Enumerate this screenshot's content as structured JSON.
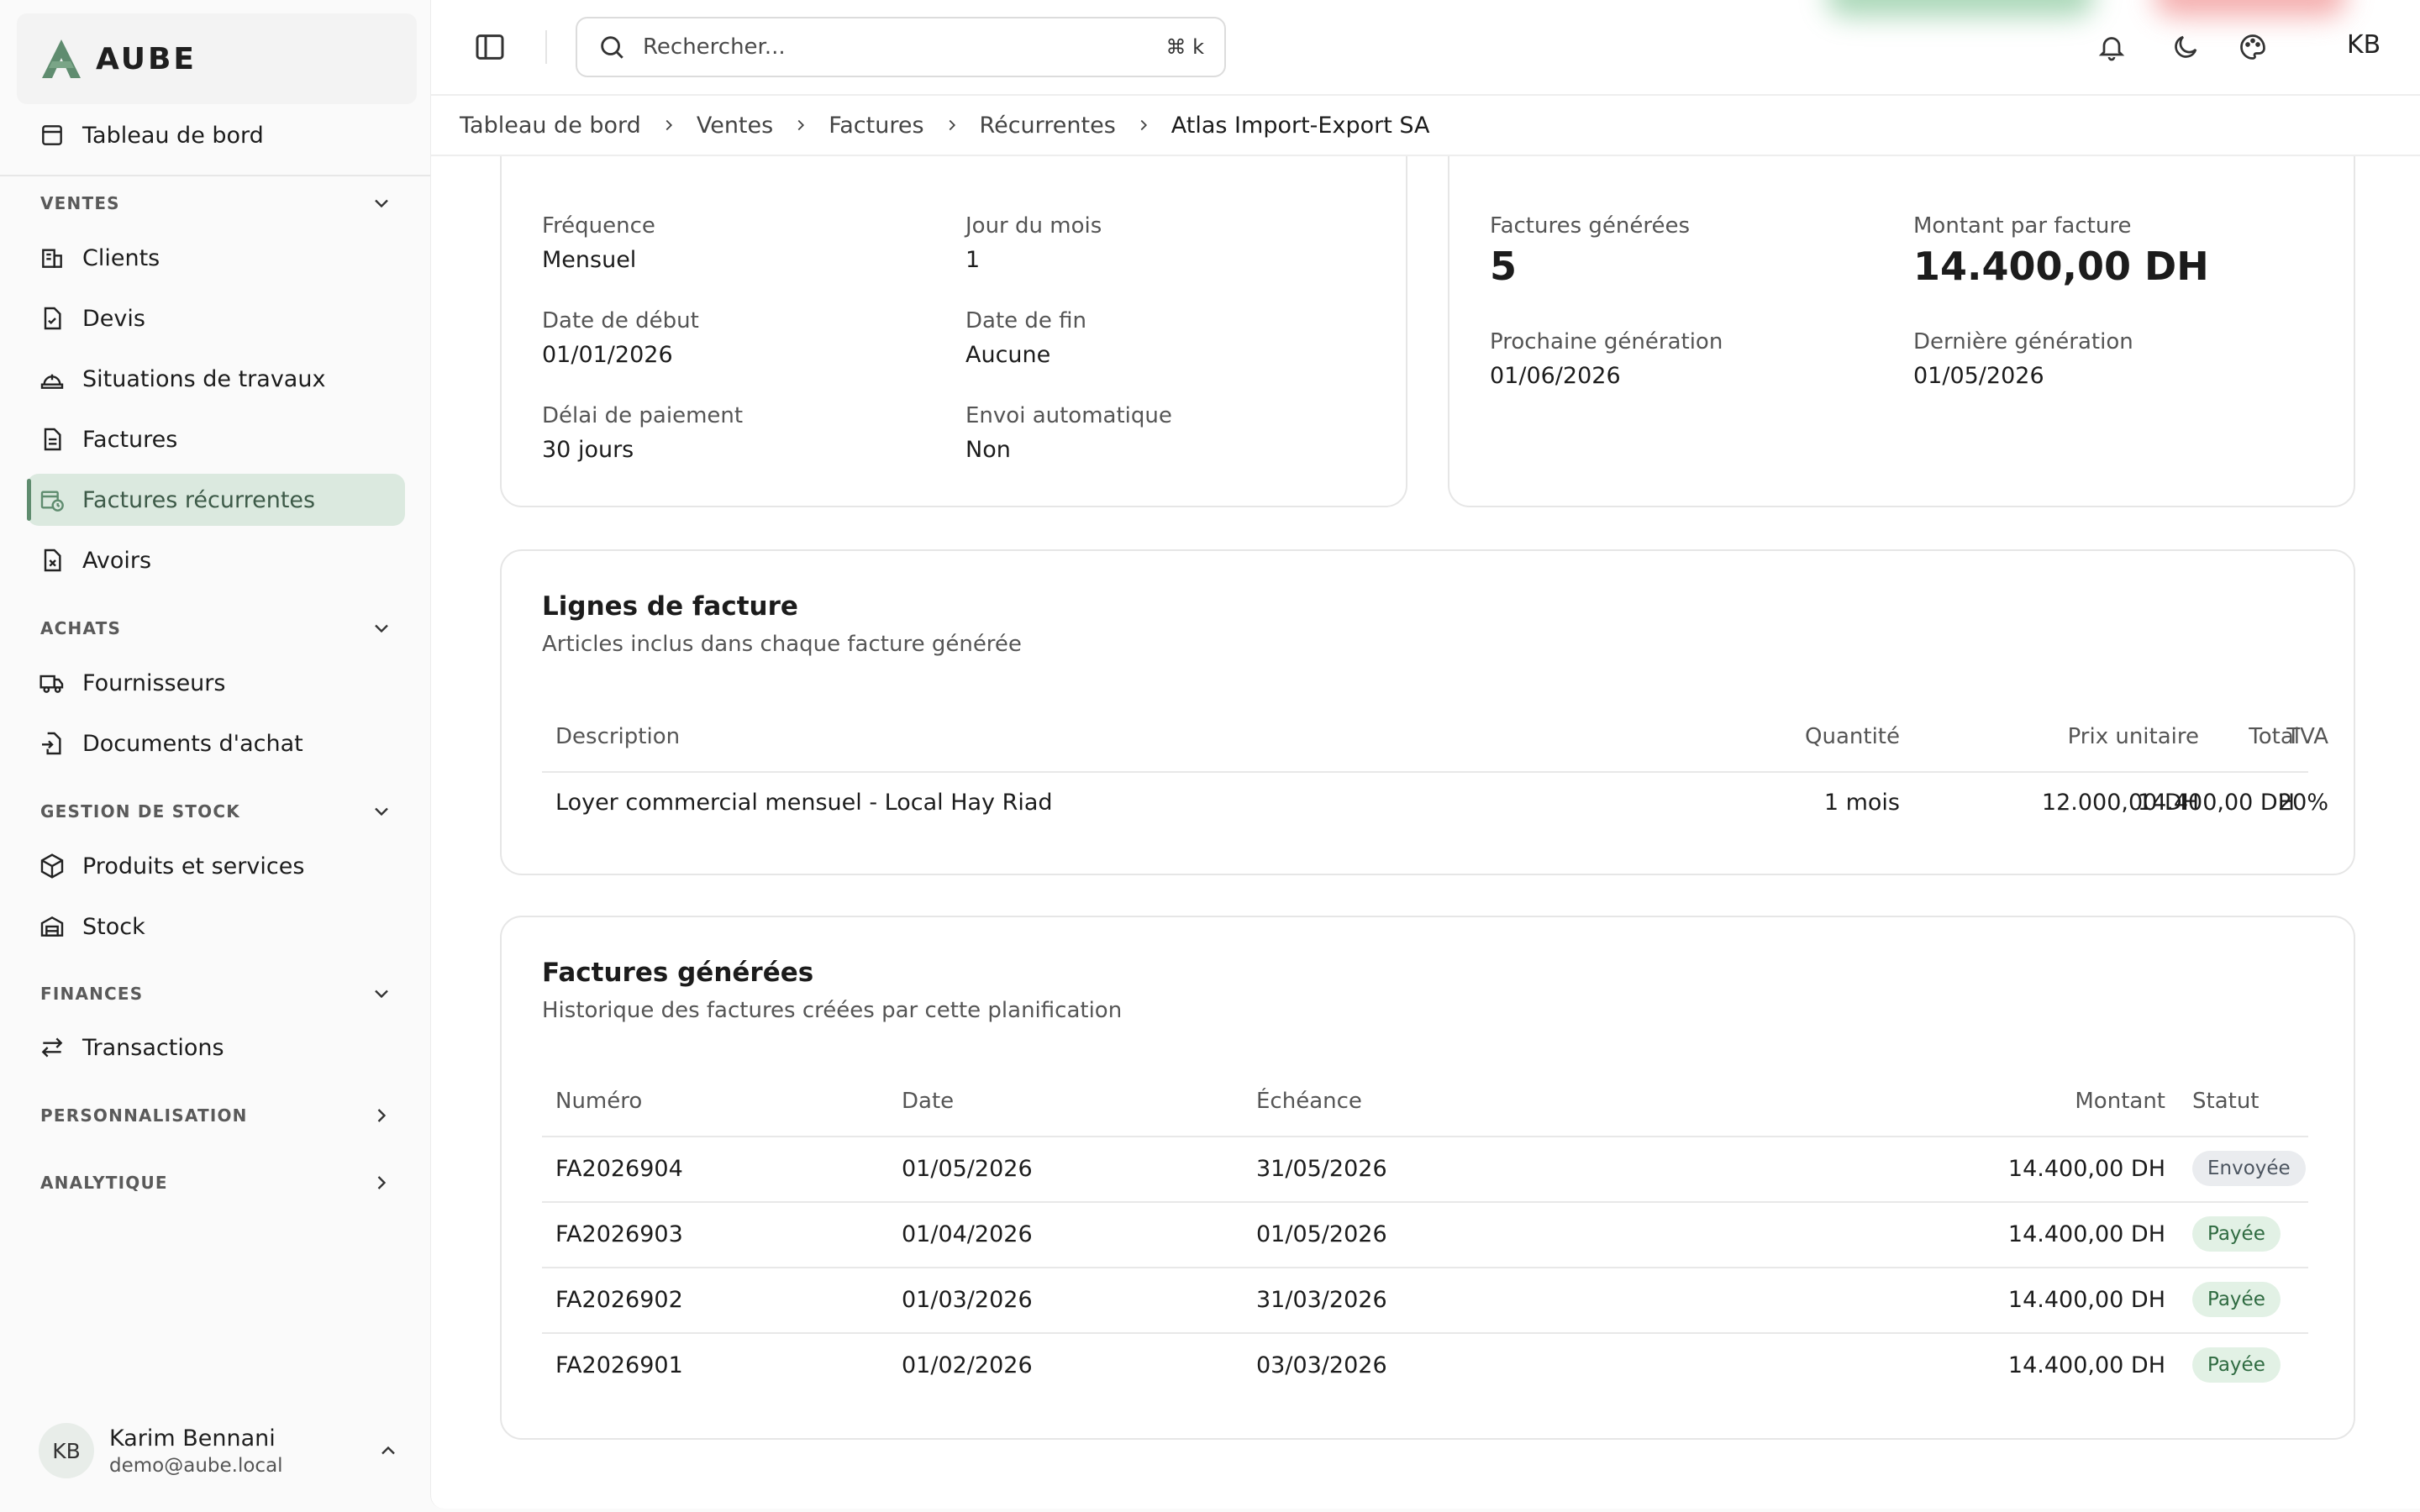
{
  "brand": {
    "name": "AUBE"
  },
  "sidebar": {
    "dashboard": "Tableau de bord",
    "sections": {
      "ventes": "VENTES",
      "achats": "ACHATS",
      "stock": "GESTION DE STOCK",
      "finances": "FINANCES",
      "perso": "PERSONNALISATION",
      "analytique": "ANALYTIQUE"
    },
    "items": {
      "clients": "Clients",
      "devis": "Devis",
      "situations": "Situations de travaux",
      "factures": "Factures",
      "recurrentes": "Factures récurrentes",
      "avoirs": "Avoirs",
      "fournisseurs": "Fournisseurs",
      "docs_achat": "Documents d'achat",
      "produits": "Produits et services",
      "stock": "Stock",
      "transactions": "Transactions"
    },
    "user": {
      "initials": "KB",
      "name": "Karim Bennani",
      "email": "demo@aube.local"
    }
  },
  "topbar": {
    "search_placeholder": "Rechercher...",
    "shortcut": "⌘ k",
    "user_initials": "KB"
  },
  "breadcrumb": [
    "Tableau de bord",
    "Ventes",
    "Factures",
    "Récurrentes",
    "Atlas Import-Export SA"
  ],
  "schedule": {
    "frequence_label": "Fréquence",
    "frequence": "Mensuel",
    "jour_label": "Jour du mois",
    "jour": "1",
    "debut_label": "Date de début",
    "debut": "01/01/2026",
    "fin_label": "Date de fin",
    "fin": "Aucune",
    "delai_label": "Délai de paiement",
    "delai": "30 jours",
    "envoi_label": "Envoi automatique",
    "envoi": "Non"
  },
  "stats": {
    "generees_label": "Factures générées",
    "generees": "5",
    "montant_label": "Montant par facture",
    "montant": "14.400,00 DH",
    "prochaine_label": "Prochaine génération",
    "prochaine": "01/06/2026",
    "derniere_label": "Dernière génération",
    "derniere": "01/05/2026"
  },
  "lines": {
    "title": "Lignes de facture",
    "subtitle": "Articles inclus dans chaque facture générée",
    "headers": {
      "description": "Description",
      "quantite": "Quantité",
      "prix": "Prix unitaire",
      "tva": "TVA",
      "total": "Total"
    },
    "rows": [
      {
        "description": "Loyer commercial mensuel - Local Hay Riad",
        "quantite": "1 mois",
        "prix": "12.000,00 DH",
        "tva": "20%",
        "total": "14.400,00 DH"
      }
    ]
  },
  "invoices": {
    "title": "Factures générées",
    "subtitle": "Historique des factures créées par cette planification",
    "headers": {
      "numero": "Numéro",
      "date": "Date",
      "echeance": "Échéance",
      "montant": "Montant",
      "statut": "Statut"
    },
    "rows": [
      {
        "numero": "FA2026904",
        "date": "01/05/2026",
        "echeance": "31/05/2026",
        "montant": "14.400,00 DH",
        "statut": "Envoyée"
      },
      {
        "numero": "FA2026903",
        "date": "01/04/2026",
        "echeance": "01/05/2026",
        "montant": "14.400,00 DH",
        "statut": "Payée"
      },
      {
        "numero": "FA2026902",
        "date": "01/03/2026",
        "echeance": "31/03/2026",
        "montant": "14.400,00 DH",
        "statut": "Payée"
      },
      {
        "numero": "FA2026901",
        "date": "01/02/2026",
        "echeance": "03/03/2026",
        "montant": "14.400,00 DH",
        "statut": "Payée"
      }
    ]
  }
}
